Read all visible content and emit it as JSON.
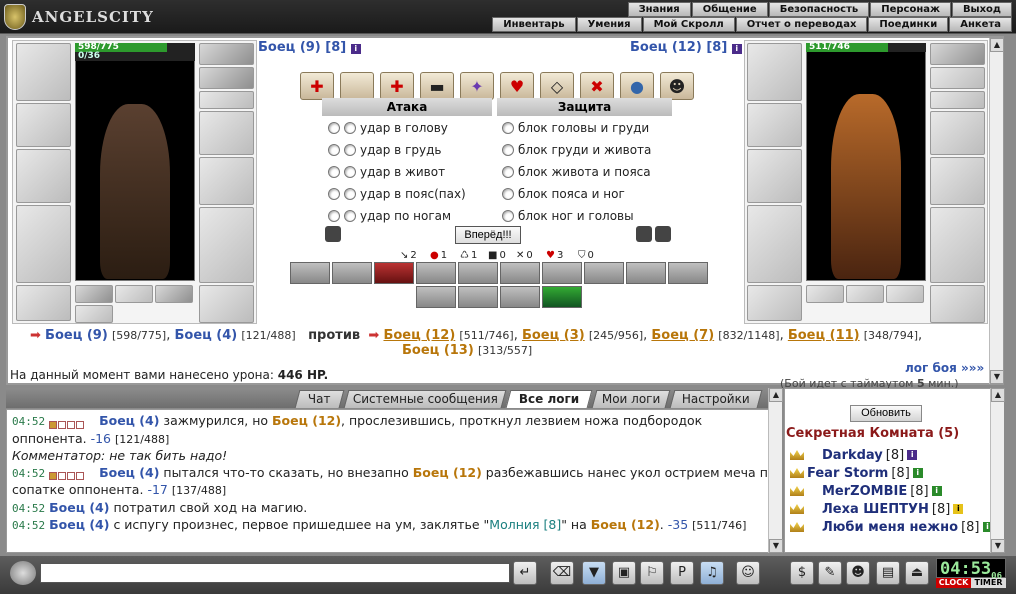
{
  "app": {
    "logo_text": "ANGELSCITY"
  },
  "menu_top": [
    "Знания",
    "Общение",
    "Безопасность",
    "Персонаж",
    "Выход"
  ],
  "menu_bottom": [
    "Инвентарь",
    "Умения",
    "Мой Скролл",
    "Отчет о переводах",
    "Поединки",
    "Анкета"
  ],
  "left_fighter": {
    "name": "Боец (9)",
    "level": "[8]",
    "hp": "598/775",
    "mp": "0/36",
    "hp_fraction": 0.77,
    "mp_fraction": 0.0
  },
  "right_fighter": {
    "name": "Боец (12)",
    "level": "[8]",
    "hp": "511/746",
    "hp_fraction": 0.68
  },
  "attack": {
    "title": "Атака",
    "options": [
      "удар в голову",
      "удар в грудь",
      "удар в живот",
      "удар в пояс(пах)",
      "удар по ногам"
    ]
  },
  "defense": {
    "title": "Защита",
    "options": [
      "блок головы и груди",
      "блок груди и живота",
      "блок живота и пояса",
      "блок пояса и ног",
      "блок ног и головы"
    ]
  },
  "forward_button": "Вперёд!!!",
  "stats": [
    "2",
    "1",
    "1",
    "0",
    "0",
    "3",
    "0"
  ],
  "versus": {
    "team1": [
      {
        "name": "Боец (9)",
        "hp": "[598/775]"
      },
      {
        "name": "Боец (4)",
        "hp": "[121/488]"
      }
    ],
    "vs_word": "против",
    "team2": [
      {
        "name": "Боец (12)",
        "hp": "[511/746]"
      },
      {
        "name": "Боец (3)",
        "hp": "[245/956]"
      },
      {
        "name": "Боец (7)",
        "hp": "[832/1148]"
      },
      {
        "name": "Боец (11)",
        "hp": "[348/794]"
      },
      {
        "name": "Боец (13)",
        "hp": "[313/557]"
      }
    ]
  },
  "damage_text": "На данный момент вами нанесено урона:",
  "damage_value": "446 HP.",
  "battle_log_link": "лог боя »»»",
  "timeout_text": "(Бой идет с таймаутом",
  "timeout_value": "5",
  "timeout_unit": "мин.)",
  "tabs": [
    "Чат",
    "Системные сообщения",
    "Все логи",
    "Мои логи",
    "Настройки"
  ],
  "log": {
    "l1_time": "04:52",
    "l1_a": "Боец (4)",
    "l1_t1": "зажмурился, но",
    "l1_b": "Боец (12)",
    "l1_t2": "прослезившись, проткнул лезвием ножа подбородок оппонента.",
    "l1_dmg": "-16",
    "l1_hp": "[121/488]",
    "l2": "Комментатор: не так бить надо!",
    "l3_time": "04:52",
    "l3_a": "Боец (4)",
    "l3_t1": "пытался что-то сказать, но внезапно",
    "l3_b": "Боец (12)",
    "l3_t2": "разбежавшись нанес укол острием меча по сопатке оппонента.",
    "l3_dmg": "-17",
    "l3_hp": "[137/488]",
    "l4_time": "04:52",
    "l4_a": "Боец (4)",
    "l4_t1": "потратил свой ход на магию.",
    "l5_time": "04:52",
    "l5_a": "Боец (4)",
    "l5_t1": "с испугу произнес, первое пришедшее на ум, заклятье \"",
    "l5_spell": "Молния [8]",
    "l5_t2": "\" на",
    "l5_b": "Боец (12)",
    "l5_dmg": "-35",
    "l5_hp": "[511/746]"
  },
  "right_panel": {
    "refresh": "Обновить",
    "room_title": "Секретная Комната (5)",
    "users": [
      {
        "name": "Darkday",
        "level": "[8]"
      },
      {
        "name": "Fear Storm",
        "level": "[8]"
      },
      {
        "name": "MerZOMBIE",
        "level": "[8]"
      },
      {
        "name": "Леха ШЕПТУН",
        "level": "[8]"
      },
      {
        "name": "Люби меня нежно",
        "level": "[8]"
      }
    ]
  },
  "clock": {
    "time": "04:53",
    "seconds": "06",
    "label1": "CLOCK",
    "label2": "TIMER"
  },
  "colors": {
    "blue_name": "#3355aa",
    "gold_name": "#b8760a",
    "room_title": "#8b1a1a"
  }
}
